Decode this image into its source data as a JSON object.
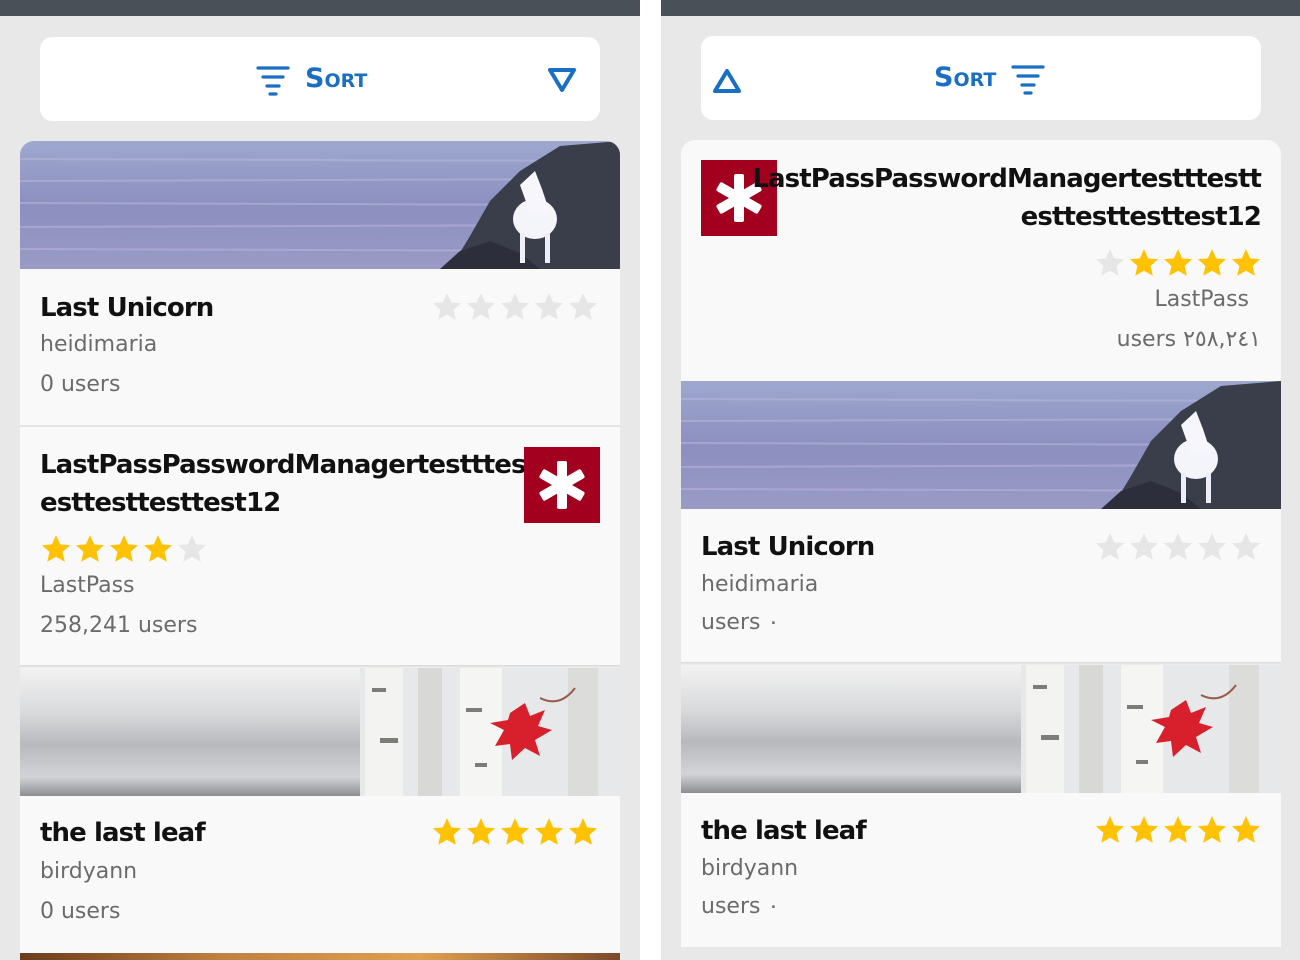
{
  "colors": {
    "accent": "#1a6fc4",
    "star_on": "#ffc200",
    "star_off": "#e6e6e6",
    "topbar": "#4a5058",
    "lastpass_red": "#a3001f"
  },
  "ltr": {
    "sort": {
      "label": "Sort",
      "icon": "filter-lines-icon",
      "toggle_icon": "triangle-down-icon"
    },
    "cards": [
      {
        "title": "Last Unicorn",
        "author": "heidimaria",
        "users": "0 users",
        "rating": 0,
        "banner": "unicorn-lake-banner"
      },
      {
        "title_line1": "LastPassPasswordManagertestttestt",
        "title_line2": "esttesttesttest12",
        "author": "LastPass",
        "users": "258,241 users",
        "rating": 4,
        "icon": "lastpass-asterisk-icon"
      },
      {
        "title": "the last leaf",
        "author": "birdyann",
        "users": "0 users",
        "rating": 5,
        "banner": "birch-leaf-banner"
      }
    ]
  },
  "rtl": {
    "sort": {
      "label": "Sort",
      "icon": "filter-lines-icon",
      "toggle_icon": "triangle-up-icon"
    },
    "cards": [
      {
        "title_line1": "LastPassPasswordManagertestttestt",
        "title_line2": "esttesttesttest12",
        "author": "LastPass",
        "users": "users ٢٥٨,٢٤١",
        "rating": 4,
        "icon": "lastpass-asterisk-icon"
      },
      {
        "title": "Last Unicorn",
        "author": "heidimaria",
        "users": "users ٠",
        "rating": 0,
        "banner": "unicorn-lake-banner"
      },
      {
        "title": "the last leaf",
        "author": "birdyann",
        "users": "users ٠",
        "rating": 5,
        "banner": "birch-leaf-banner"
      }
    ]
  }
}
